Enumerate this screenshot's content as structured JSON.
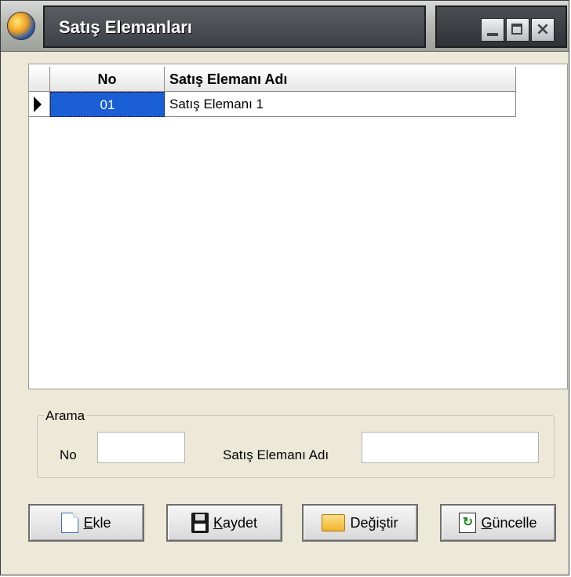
{
  "window": {
    "title": "Satış Elemanları"
  },
  "grid": {
    "columns": [
      "No",
      "Satış Elemanı Adı"
    ],
    "rows": [
      {
        "no": "01",
        "name": "Satış Elemanı 1",
        "selected": true
      }
    ]
  },
  "search": {
    "legend": "Arama",
    "no_label": "No",
    "no_value": "",
    "name_label": "Satış Elemanı Adı",
    "name_value": ""
  },
  "buttons": {
    "add": {
      "mnemonic": "E",
      "rest": "kle",
      "icon": "new-document-icon"
    },
    "save": {
      "mnemonic": "K",
      "rest": "aydet",
      "icon": "floppy-disk-icon"
    },
    "edit": {
      "pre": "De",
      "mnemonic": "ğ",
      "rest": "iştir",
      "icon": "folder-icon"
    },
    "update": {
      "mnemonic": "G",
      "rest": "üncelle",
      "icon": "refresh-icon"
    }
  },
  "colors": {
    "selection": "#1a5fd6",
    "window_bg": "#ece9d8"
  }
}
